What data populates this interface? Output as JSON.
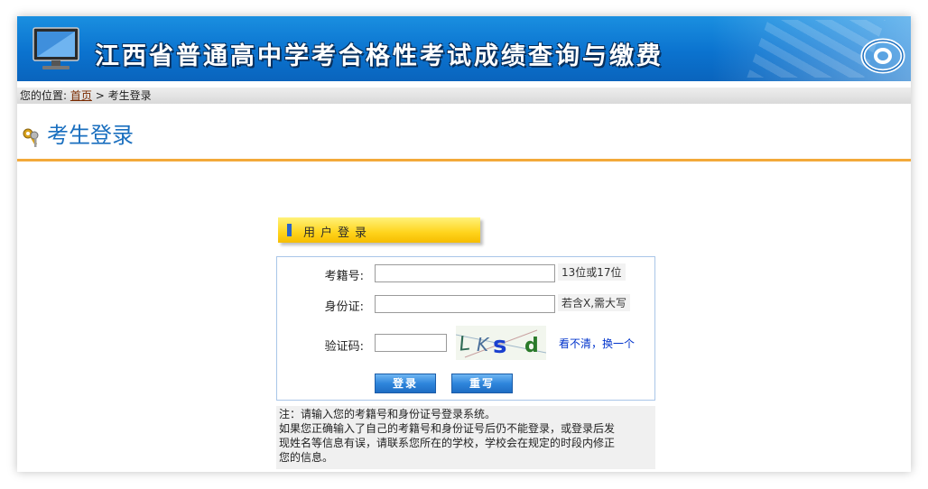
{
  "banner": {
    "title": "江西省普通高中学考合格性考试成绩查询与缴费"
  },
  "breadcrumb": {
    "prefix": "您的位置:",
    "home_link": "首页",
    "separator": ">",
    "current": "考生登录"
  },
  "page": {
    "title": "考生登录"
  },
  "login": {
    "tab_label": "用户登录",
    "exam_no_label": "考籍号:",
    "exam_no_value": "",
    "exam_no_hint": "13位或17位",
    "id_label": "身份证:",
    "id_value": "",
    "id_hint": "若含X,需大写",
    "captcha_label": "验证码:",
    "captcha_value": "",
    "captcha_text": "LKsd",
    "refresh_link": "看不清，换一个",
    "login_button": "登录",
    "reset_button": "重写"
  },
  "note": {
    "lines": [
      "注：请输入您的考籍号和身份证号登录系统。",
      "如果您正确输入了自己的考籍号和身份证号后仍不能登录，或登录后发",
      "现姓名等信息有误，请联系您所在的学校，学校会在规定的时段内修正",
      "您的信息。"
    ]
  },
  "colors": {
    "banner_blue": "#0b73cf",
    "title_blue": "#1a6fbf",
    "accent_orange": "#f3a93a",
    "tab_yellow": "#ffd41c",
    "link_blue": "#0033cc"
  },
  "icons": [
    "monitor-icon",
    "at-sign-icon",
    "keys-icon",
    "captcha-image"
  ]
}
